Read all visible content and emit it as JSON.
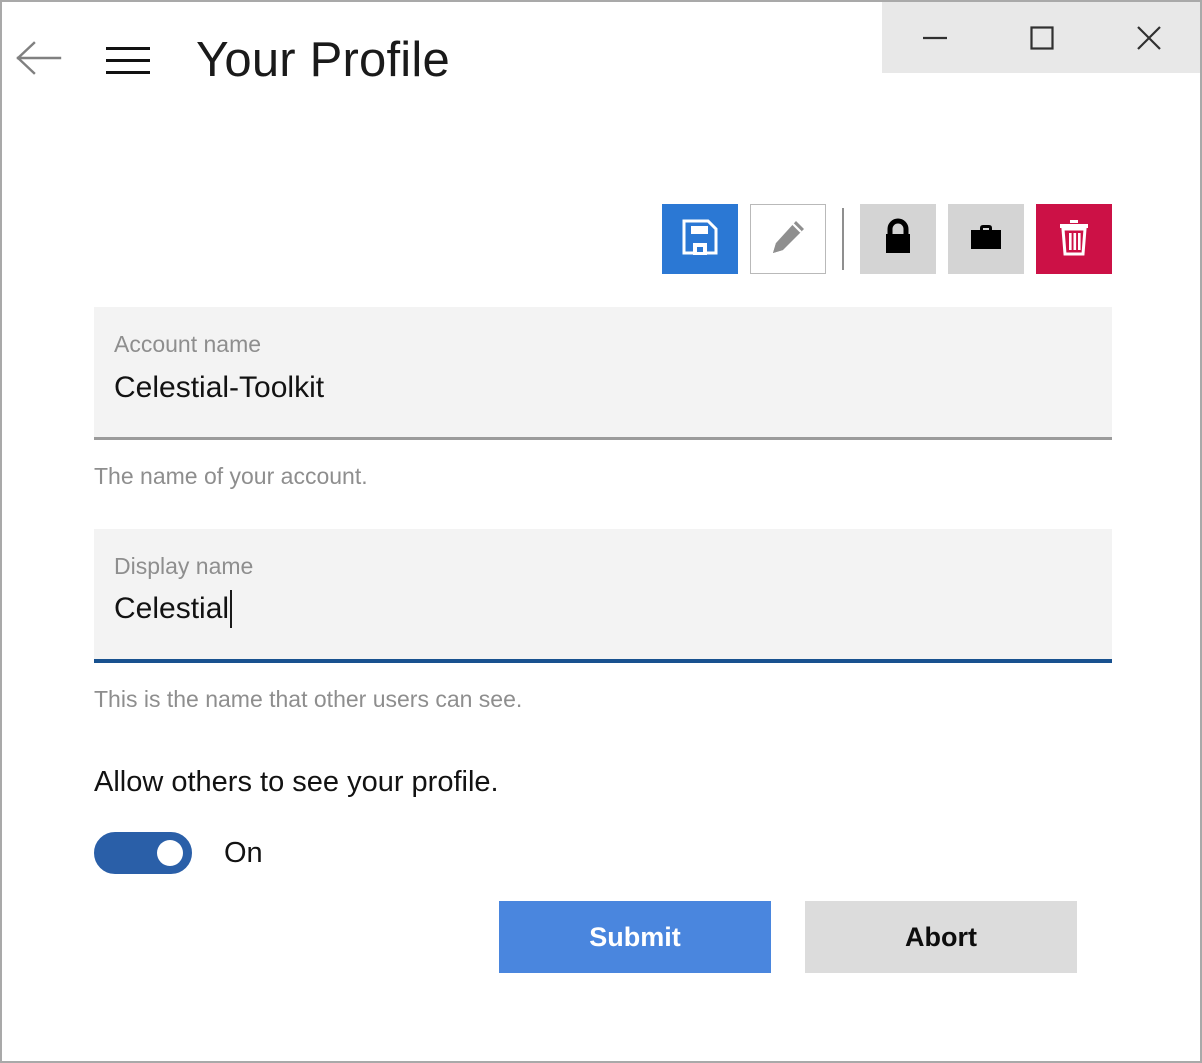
{
  "window": {
    "title": "Your Profile",
    "controls": {
      "minimize_label": "Minimize",
      "maximize_label": "Maximize",
      "close_label": "Close"
    },
    "nav": {
      "back_label": "Back",
      "menu_label": "Menu"
    }
  },
  "toolbar": {
    "items": [
      {
        "name": "save",
        "label": "Save",
        "icon": "floppy-disk-icon",
        "color": "#2b78d4"
      },
      {
        "name": "edit",
        "label": "Edit",
        "icon": "pencil-icon",
        "color": "#ffffff"
      },
      {
        "name": "lock",
        "label": "Lock",
        "icon": "lock-icon",
        "color": "#d4d4d4"
      },
      {
        "name": "briefcase",
        "label": "Work",
        "icon": "briefcase-icon",
        "color": "#d4d4d4"
      },
      {
        "name": "delete",
        "label": "Delete",
        "icon": "trash-icon",
        "color": "#cc1146"
      }
    ]
  },
  "form": {
    "fields": [
      {
        "label": "Account name",
        "value": "Celestial-Toolkit",
        "help": "The name of your account.",
        "focused": false
      },
      {
        "label": "Display name",
        "value": "Celestial",
        "help": "This is the name that other users can see.",
        "focused": true
      }
    ],
    "toggle": {
      "caption": "Allow others to see your profile.",
      "state_label": "On",
      "checked": true
    }
  },
  "actions": {
    "submit_label": "Submit",
    "abort_label": "Abort"
  },
  "colors": {
    "accent_blue": "#2b78d4",
    "submit_blue": "#4a86de",
    "focus_blue": "#18518f",
    "toggle_blue": "#2a5fa8",
    "danger_red": "#cc1146",
    "field_bg": "#f3f3f3",
    "neutral_gray": "#d4d4d4"
  }
}
